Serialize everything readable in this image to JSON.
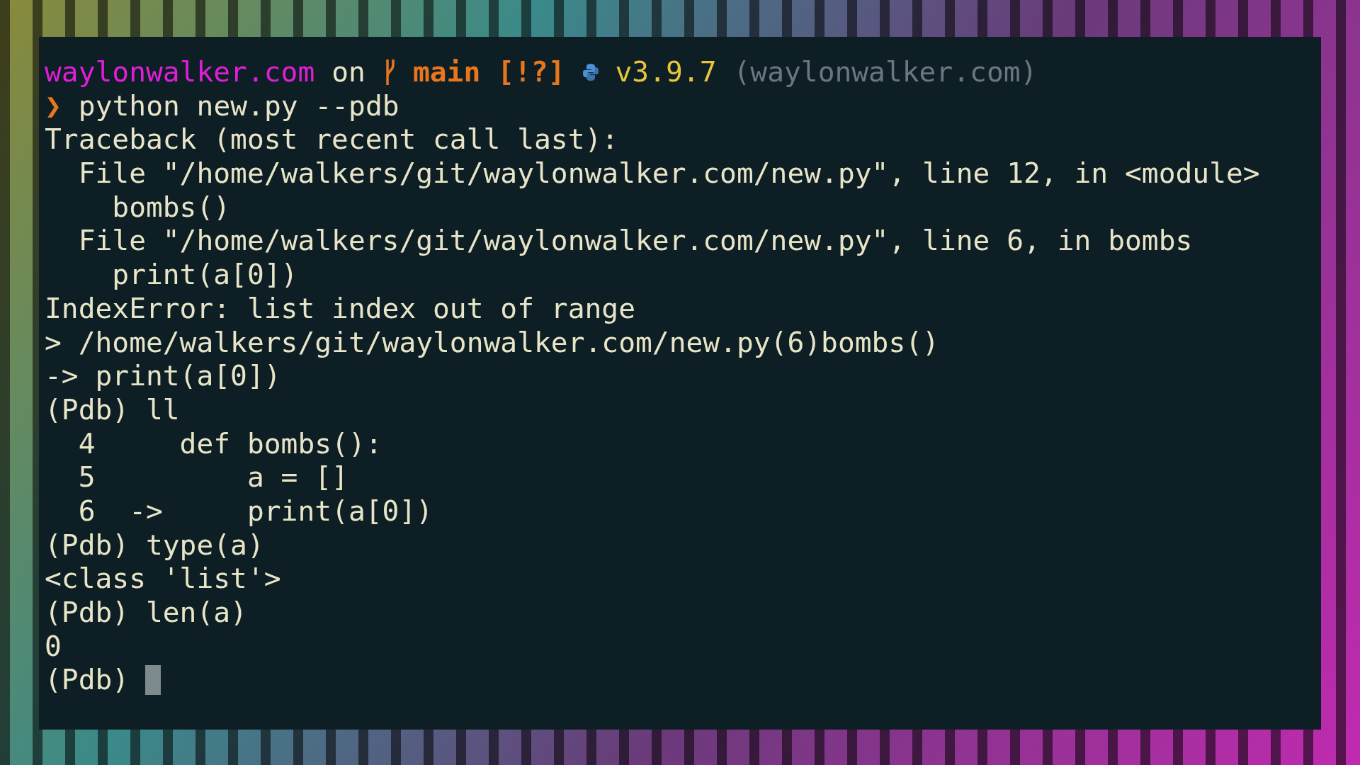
{
  "prompt": {
    "segments": [
      {
        "kind": "text",
        "text": "waylonwalker.com",
        "color": "#e01ed8",
        "bold": false
      },
      {
        "kind": "text",
        "text": "on",
        "color": "#e8e4c8",
        "bold": false
      },
      {
        "kind": "branch-icon",
        "color": "#e8761f"
      },
      {
        "kind": "text",
        "text": "main",
        "color": "#e8761f",
        "bold": true
      },
      {
        "kind": "text",
        "text": "[!?]",
        "color": "#e8761f",
        "bold": true
      },
      {
        "kind": "python-icon",
        "color": "#4a90d9"
      },
      {
        "kind": "text",
        "text": "v3.9.7",
        "color": "#e8c53a",
        "bold": false
      },
      {
        "kind": "text",
        "text": "(waylonwalker.com)",
        "color": "#6b7680",
        "bold": false
      }
    ],
    "symbol": "❯",
    "command": "python new.py --pdb"
  },
  "output": [
    "Traceback (most recent call last):",
    "  File \"/home/walkers/git/waylonwalker.com/new.py\", line 12, in <module>",
    "    bombs()",
    "  File \"/home/walkers/git/waylonwalker.com/new.py\", line 6, in bombs",
    "    print(a[0])",
    "IndexError: list index out of range",
    "> /home/walkers/git/waylonwalker.com/new.py(6)bombs()",
    "-> print(a[0])",
    "(Pdb) ll",
    "  4     def bombs():",
    "  5         a = []",
    "  6  ->     print(a[0])",
    "(Pdb) type(a)",
    "<class 'list'>",
    "(Pdb) len(a)",
    "0"
  ],
  "input_line": {
    "prompt": "(Pdb)",
    "cursor": true
  }
}
